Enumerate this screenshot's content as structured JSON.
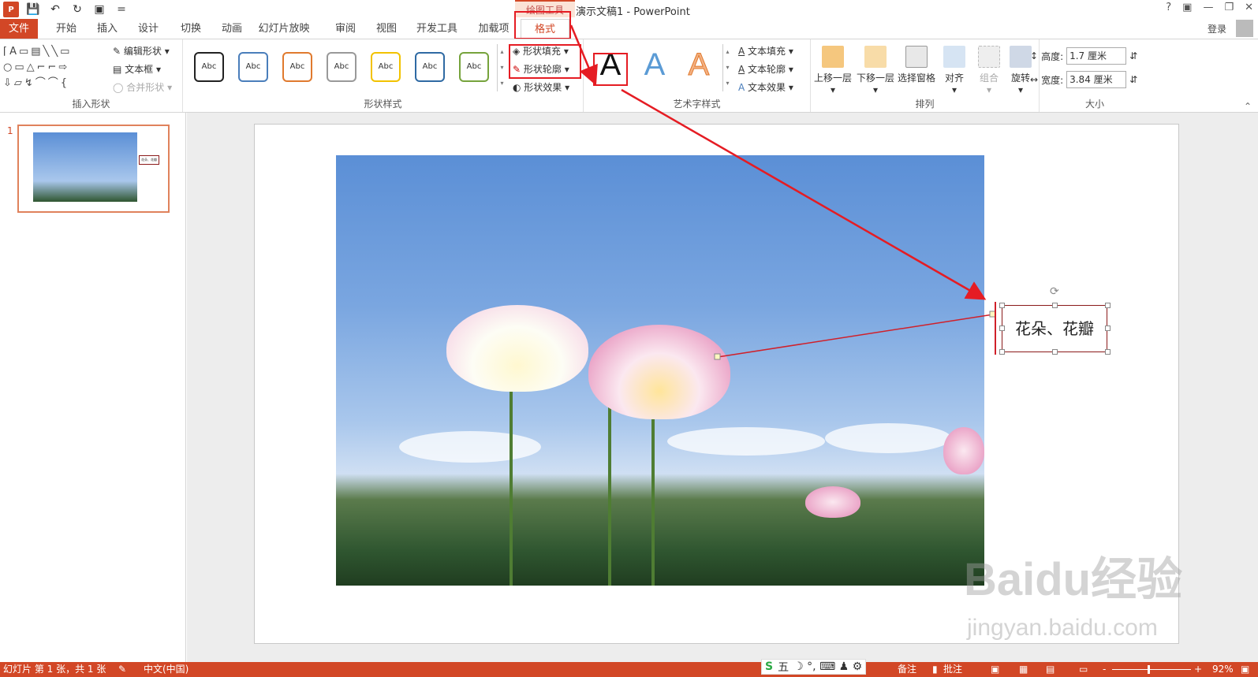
{
  "titlebar": {
    "app_icon": "P",
    "title": "演示文稿1 - PowerPoint",
    "context_tab": "绘图工具",
    "help": "?",
    "qat_dropdown": "="
  },
  "tabs": {
    "file": "文件",
    "items": [
      "开始",
      "插入",
      "设计",
      "切换",
      "动画",
      "幻灯片放映",
      "审阅",
      "视图",
      "开发工具",
      "加载项"
    ],
    "format": "格式",
    "login": "登录"
  },
  "ribbon": {
    "insert_shapes": {
      "label": "插入形状",
      "edit_shape": "编辑形状",
      "textbox": "文本框",
      "merge_shapes": "合并形状"
    },
    "shape_styles": {
      "label": "形状样式",
      "abc": "Abc",
      "fill": "形状填充",
      "outline": "形状轮廓",
      "effects": "形状效果"
    },
    "wordart": {
      "label": "艺术字样式",
      "letter": "A",
      "text_fill": "文本填充",
      "text_outline": "文本轮廓",
      "text_effects": "文本效果"
    },
    "arrange": {
      "label": "排列",
      "bring_forward": "上移一层",
      "send_backward": "下移一层",
      "selection_pane": "选择窗格",
      "align": "对齐",
      "group": "组合",
      "rotate": "旋转"
    },
    "size": {
      "label": "大小",
      "height_label": "高度:",
      "height_value": "1.7 厘米",
      "width_label": "宽度:",
      "width_value": "3.84 厘米"
    }
  },
  "slides": {
    "number": "1",
    "thumb_text": "花朵、花瓣"
  },
  "slide": {
    "textbox_text": "花朵、花瓣"
  },
  "status": {
    "slide_info": "幻灯片 第 1 张，共 1 张",
    "language": "中文(中国)",
    "notes": "备注",
    "comments": "批注",
    "zoom": "92%",
    "zoom_minus": "-",
    "zoom_plus": "+"
  },
  "ime": {
    "logo": "S",
    "mode": "五",
    "icons": "☽ °, ⌨ ♟ ⚙"
  },
  "watermark": {
    "text": "Baidu经验",
    "url": "jingyan.baidu.com"
  },
  "colors": {
    "accent": "#d24726",
    "highlight": "#e51c23"
  }
}
